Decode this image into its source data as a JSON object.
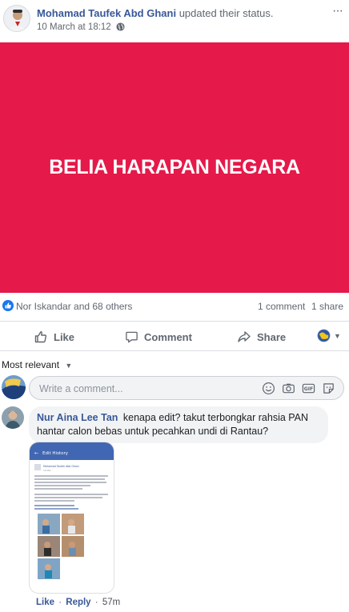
{
  "post": {
    "author": "Mohamad Taufek Abd Ghani",
    "action": "updated their status.",
    "timestamp": "10 March at 18:12",
    "more_glyph": "···",
    "status_text": "BELIA HARAPAN NEGARA",
    "status_bg_color": "#e5194a"
  },
  "reactions": {
    "summary": "Nor Iskandar and 68 others",
    "comments": "1 comment",
    "shares": "1 share",
    "like_color": "#1877f2"
  },
  "actions": {
    "like_label": "Like",
    "comment_label": "Comment",
    "share_label": "Share"
  },
  "comments_section": {
    "sort_label": "Most relevant",
    "composer_placeholder": "Write a comment..."
  },
  "comment": {
    "author": "Nur Aina Lee Tan",
    "text": "kenapa edit? takut terbongkar rahsia PAN hantar calon bebas untuk pecahkan undi di Rantau?",
    "like_label": "Like",
    "reply_label": "Reply",
    "age": "57m",
    "image": {
      "header_title": "Edit History",
      "poster": "Mohamad Taufek Abd Ghani",
      "poster_date": "10 Mar"
    }
  },
  "icons": [
    "avatar",
    "globe-icon",
    "more-icon",
    "like-icon",
    "comment-icon",
    "share-icon",
    "audience-icon",
    "caret-down-icon",
    "emoji-icon",
    "camera-icon",
    "gif-icon",
    "sticker-icon"
  ]
}
